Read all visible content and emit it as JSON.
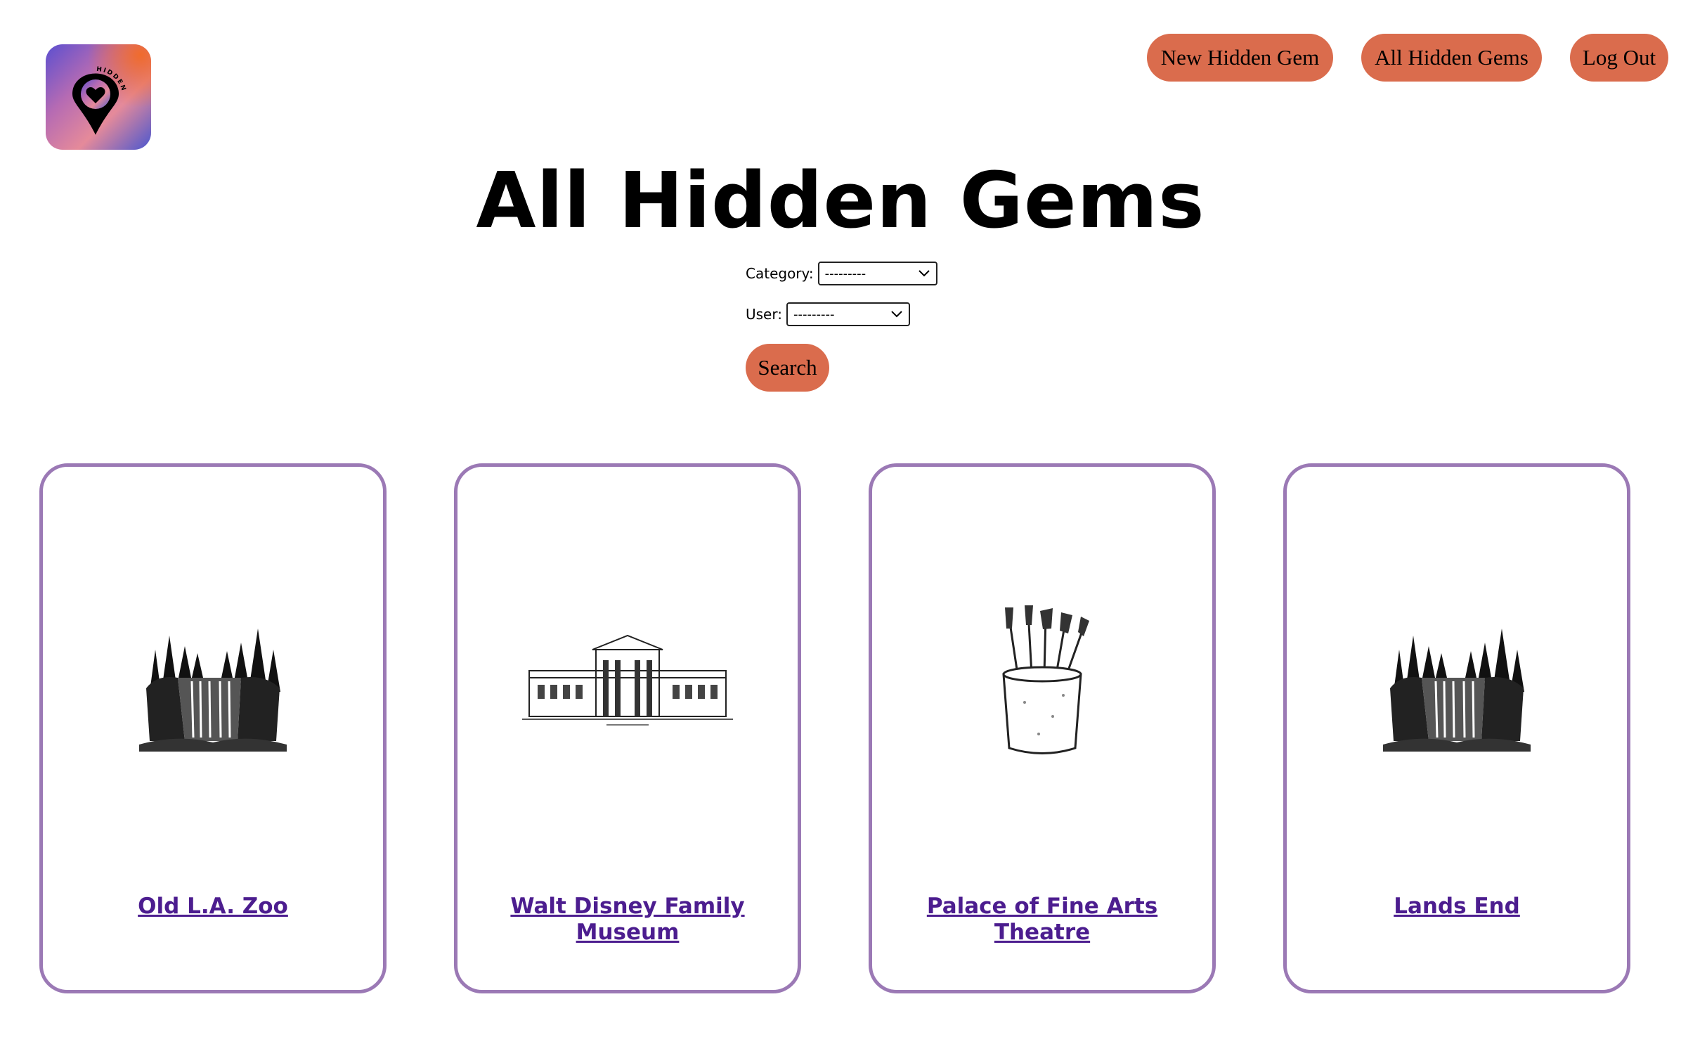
{
  "logo": {
    "alt": "HIDDEN GEM",
    "ring_text": "HIDDEN GEM",
    "colors": [
      "#6a4fc4",
      "#e46a3b",
      "#e28bb0",
      "#4c5bd0"
    ]
  },
  "nav": {
    "new_label": "New Hidden Gem",
    "all_label": "All Hidden Gems",
    "logout_label": "Log Out",
    "button_color": "#da6c4d"
  },
  "page": {
    "title": "All Hidden Gems"
  },
  "filters": {
    "category_label": "Category:",
    "category_value": "---------",
    "user_label": "User:",
    "user_value": "---------",
    "search_label": "Search"
  },
  "cards": [
    {
      "name": "Old L.A. Zoo",
      "icon": "waterfall-icon"
    },
    {
      "name": "Walt Disney Family Museum",
      "icon": "museum-building-icon"
    },
    {
      "name": "Palace of Fine Arts Theatre",
      "icon": "paintbrush-jar-icon"
    },
    {
      "name": "Lands End",
      "icon": "waterfall-icon"
    }
  ],
  "colors": {
    "card_border": "#9b79b5",
    "link": "#4c1d8f"
  }
}
